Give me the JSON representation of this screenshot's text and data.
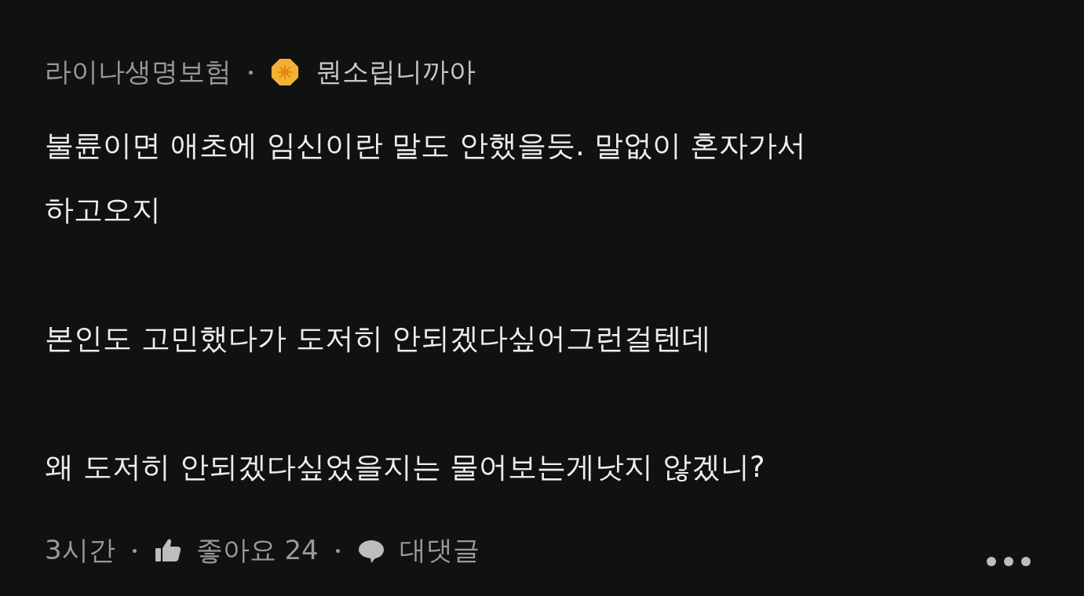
{
  "comment": {
    "company": "라이나생명보험",
    "author": "뭔소립니까아",
    "paragraphs": [
      [
        "불륜이면 애초에 임신이란 말도 안했을듯. 말없이 혼자가서",
        "하고오지"
      ],
      [
        "본인도 고민했다가 도저히 안되겠다싶어그런걸텐데"
      ],
      [
        "왜 도저히 안되겠다싶었을지는 물어보는게낫지 않겠니?"
      ]
    ],
    "time": "3시간",
    "like_label": "좋아요 24",
    "reply_label": "대댓글"
  }
}
